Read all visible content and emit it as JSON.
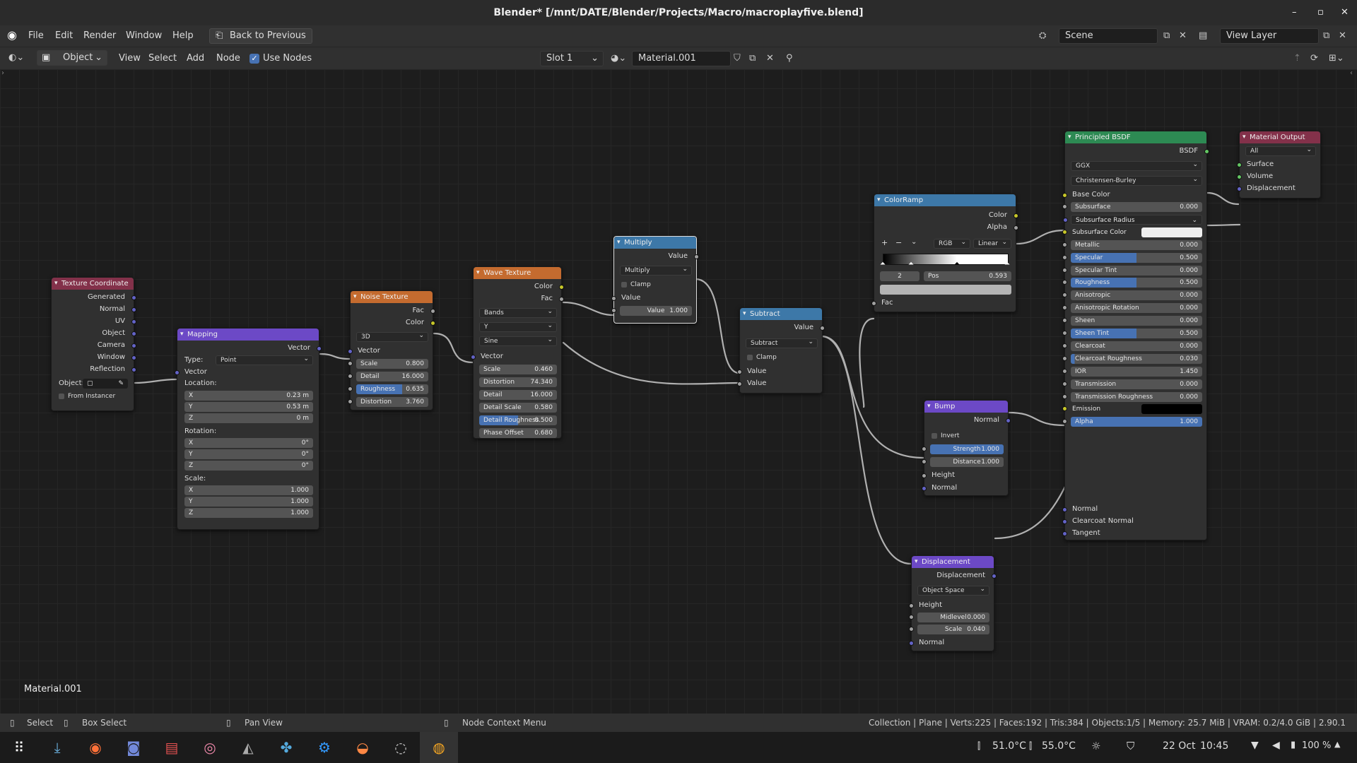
{
  "window": {
    "title": "Blender* [/mnt/DATE/Blender/Projects/Macro/macroplayfive.blend]"
  },
  "menu": [
    "File",
    "Edit",
    "Render",
    "Window",
    "Help"
  ],
  "back_button": "Back to Previous",
  "scene": {
    "name": "Scene",
    "layer": "View Layer"
  },
  "editor_header": {
    "mode": "Object",
    "items": [
      "View",
      "Select",
      "Add",
      "Node"
    ],
    "use_nodes": "Use Nodes",
    "slot": "Slot 1",
    "material": "Material.001"
  },
  "nodes": {
    "texcoord": {
      "title": "Texture Coordinate",
      "outputs": [
        "Generated",
        "Normal",
        "UV",
        "Object",
        "Camera",
        "Window",
        "Reflection"
      ],
      "object_label": "Object:",
      "from_instancer": "From Instancer"
    },
    "mapping": {
      "title": "Mapping",
      "out": "Vector",
      "type_label": "Type:",
      "type": "Point",
      "vector": "Vector",
      "location": "Location:",
      "loc": [
        [
          "X",
          "0.23 m"
        ],
        [
          "Y",
          "0.53 m"
        ],
        [
          "Z",
          "0 m"
        ]
      ],
      "rotation": "Rotation:",
      "rot": [
        [
          "X",
          "0°"
        ],
        [
          "Y",
          "0°"
        ],
        [
          "Z",
          "0°"
        ]
      ],
      "scale": "Scale:",
      "scl": [
        [
          "X",
          "1.000"
        ],
        [
          "Y",
          "1.000"
        ],
        [
          "Z",
          "1.000"
        ]
      ]
    },
    "noise": {
      "title": "Noise Texture",
      "outs": [
        "Fac",
        "Color"
      ],
      "dim": "3D",
      "vector": "Vector",
      "fields": [
        [
          "Scale",
          "0.800"
        ],
        [
          "Detail",
          "16.000"
        ],
        [
          "Roughness",
          "0.635"
        ],
        [
          "Distortion",
          "3.760"
        ]
      ]
    },
    "wave": {
      "title": "Wave Texture",
      "outs": [
        "Color",
        "Fac"
      ],
      "dds": [
        "Bands",
        "Y",
        "Sine"
      ],
      "vector": "Vector",
      "fields": [
        [
          "Scale",
          "0.460"
        ],
        [
          "Distortion",
          "74.340"
        ],
        [
          "Detail",
          "16.000"
        ],
        [
          "Detail Scale",
          "0.580"
        ],
        [
          "Detail Roughness",
          "0.500"
        ],
        [
          "Phase Offset",
          "0.680"
        ]
      ]
    },
    "multiply": {
      "title": "Multiply",
      "out": "Value",
      "op": "Multiply",
      "clamp": "Clamp",
      "in": "Value",
      "field": [
        "Value",
        "1.000"
      ]
    },
    "subtract": {
      "title": "Subtract",
      "out": "Value",
      "op": "Subtract",
      "clamp": "Clamp",
      "ins": [
        "Value",
        "Value"
      ]
    },
    "ramp": {
      "title": "ColorRamp",
      "outs": [
        "Color",
        "Alpha"
      ],
      "mode": "RGB",
      "interp": "Linear",
      "index": "2",
      "pos_label": "Pos",
      "pos": "0.593",
      "fac": "Fac"
    },
    "bump": {
      "title": "Bump",
      "out": "Normal",
      "invert": "Invert",
      "fields": [
        [
          "Strength",
          "1.000"
        ],
        [
          "Distance",
          "1.000"
        ]
      ],
      "ins": [
        "Height",
        "Normal"
      ]
    },
    "disp": {
      "title": "Displacement",
      "out": "Displacement",
      "space": "Object Space",
      "ins": [
        "Height"
      ],
      "fields": [
        [
          "Midlevel",
          "0.000"
        ],
        [
          "Scale",
          "0.040"
        ]
      ],
      "normal": "Normal"
    },
    "bsdf": {
      "title": "Principled BSDF",
      "out": "BSDF",
      "dist": "GGX",
      "sss": "Christensen-Burley",
      "base": "Base Color",
      "rows": [
        [
          "Subsurface",
          "0.000"
        ],
        [
          "Subsurface Radius",
          ""
        ],
        [
          "Subsurface Color",
          ""
        ],
        [
          "Metallic",
          "0.000"
        ],
        [
          "Specular",
          "0.500"
        ],
        [
          "Specular Tint",
          "0.000"
        ],
        [
          "Roughness",
          "0.500"
        ],
        [
          "Anisotropic",
          "0.000"
        ],
        [
          "Anisotropic Rotation",
          "0.000"
        ],
        [
          "Sheen",
          "0.000"
        ],
        [
          "Sheen Tint",
          "0.500"
        ],
        [
          "Clearcoat",
          "0.000"
        ],
        [
          "Clearcoat Roughness",
          "0.030"
        ],
        [
          "IOR",
          "1.450"
        ],
        [
          "Transmission",
          "0.000"
        ],
        [
          "Transmission Roughness",
          "0.000"
        ],
        [
          "Emission",
          ""
        ],
        [
          "Alpha",
          "1.000"
        ]
      ],
      "tail": [
        "Normal",
        "Clearcoat Normal",
        "Tangent"
      ]
    },
    "output": {
      "title": "Material Output",
      "target": "All",
      "ins": [
        "Surface",
        "Volume",
        "Displacement"
      ]
    }
  },
  "editor_label": "Material.001",
  "status": {
    "select": "Select",
    "box": "Box Select",
    "pan": "Pan View",
    "ctx": "Node Context Menu",
    "info": "Collection | Plane | Verts:225 | Faces:192 | Tris:384 | Objects:1/5 | Memory: 25.7 MiB | VRAM: 0.2/4.0 GiB | 2.90.1"
  },
  "tray": {
    "t1": "51.0°C",
    "t2": "55.0°C",
    "date": "22 Oct",
    "time": "10:45",
    "battery": "100 %"
  },
  "colors": {
    "input": "#83314a",
    "vector": "#6c49c6",
    "texture": "#c46b2f",
    "converter": "#3d78a8",
    "shader": "#2d8a53"
  }
}
